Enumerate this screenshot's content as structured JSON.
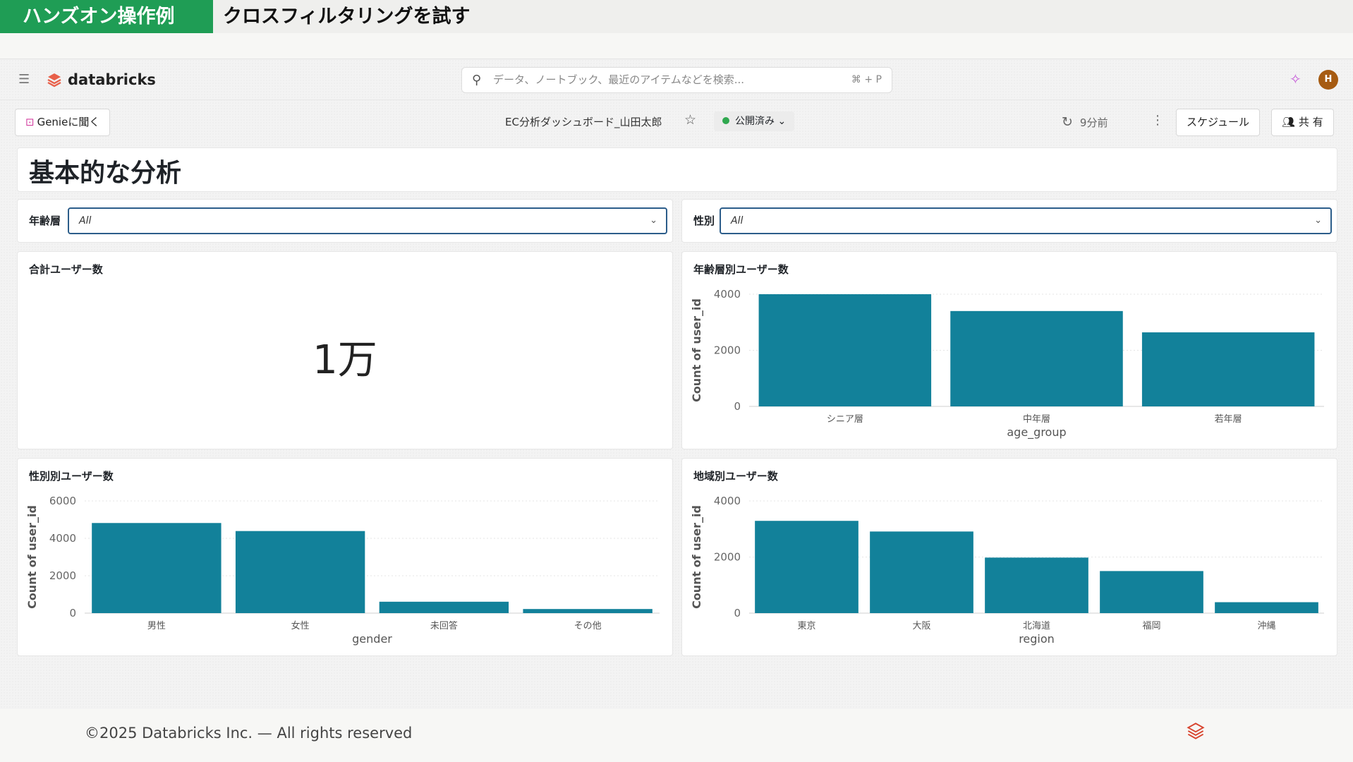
{
  "banner": {
    "tag": "ハンズオン操作例",
    "title": "クロスフィルタリングを試す"
  },
  "topbar": {
    "brand": "databricks",
    "search_placeholder": "データ、ノートブック、最近のアイテムなどを検索...",
    "search_shortcut": "⌘ + P",
    "avatar_initial": "H"
  },
  "toolbar": {
    "genie_label": "Genieに聞く",
    "dashboard_name": "EC分析ダッシュボード_山田太郎",
    "status": "公開済み",
    "refreshed": "9分前",
    "schedule_label": "スケジュール",
    "share_label": "共 有",
    "status_color": "#2fa84f"
  },
  "page": {
    "title": "基本的な分析"
  },
  "filters": [
    {
      "label": "年齢層",
      "value": "All"
    },
    {
      "label": "性別",
      "value": "All"
    }
  ],
  "counter": {
    "title": "合計ユーザー数",
    "value": "1万"
  },
  "chart_data": [
    {
      "type": "bar",
      "title": "年齢層別ユーザー数",
      "xlabel": "age_group",
      "ylabel": "Count of user_id",
      "categories": [
        "シニア層",
        "中年層",
        "若年層"
      ],
      "values": [
        4000,
        3400,
        2640
      ],
      "yticks": [
        "0",
        "2000",
        "4000"
      ],
      "ylim": [
        0,
        4000
      ],
      "color": "#12819a"
    },
    {
      "type": "bar",
      "title": "性別別ユーザー数",
      "xlabel": "gender",
      "ylabel": "Count of user_id",
      "categories": [
        "男性",
        "女性",
        "未回答",
        "その他"
      ],
      "values": [
        4820,
        4390,
        610,
        220
      ],
      "yticks": [
        "0",
        "2000",
        "4000",
        "6000"
      ],
      "ylim": [
        0,
        6000
      ],
      "color": "#12819a"
    },
    {
      "type": "bar",
      "title": "地域別ユーザー数",
      "xlabel": "region",
      "ylabel": "Count of user_id",
      "categories": [
        "東京",
        "大阪",
        "北海道",
        "福岡",
        "沖縄"
      ],
      "values": [
        3290,
        2910,
        1980,
        1500,
        390
      ],
      "yticks": [
        "0",
        "2000",
        "4000"
      ],
      "ylim": [
        0,
        4000
      ],
      "color": "#12819a"
    }
  ],
  "footer": {
    "copyright": "©2025 Databricks Inc. — All rights reserved"
  }
}
